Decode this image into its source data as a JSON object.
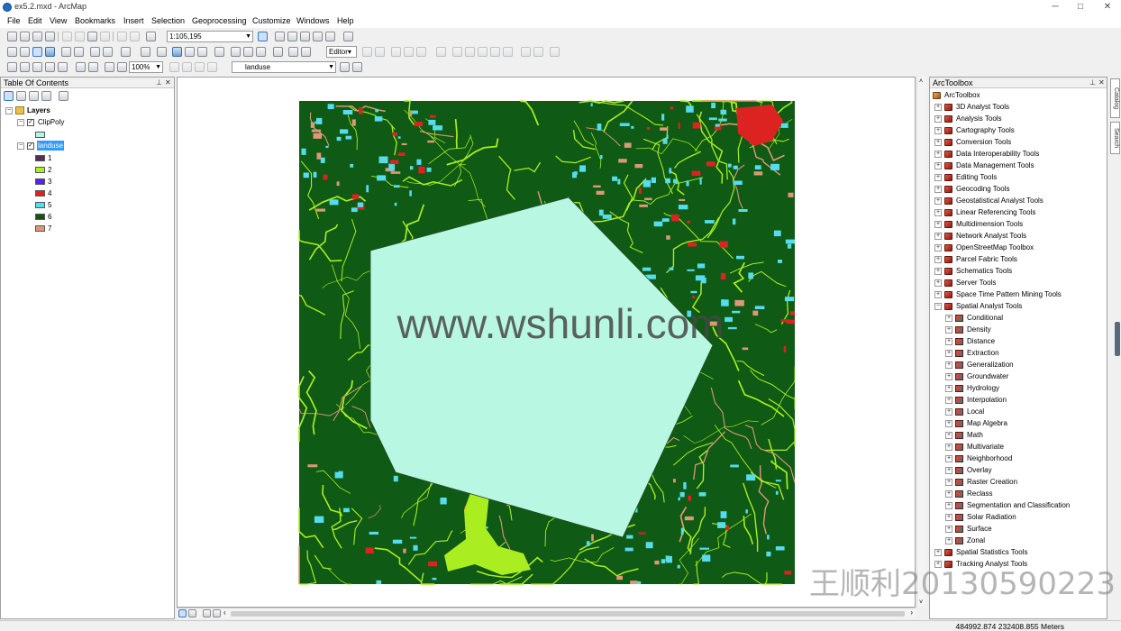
{
  "window": {
    "title": "ex5.2.mxd - ArcMap",
    "minimize": "─",
    "maximize": "□",
    "close": "✕"
  },
  "menu": [
    "File",
    "Edit",
    "View",
    "Bookmarks",
    "Insert",
    "Selection",
    "Geoprocessing",
    "Customize",
    "Windows",
    "Help"
  ],
  "toolbar": {
    "scale": "1:105,195",
    "zoom": "100%",
    "editor": "Editor▾",
    "layer": "landuse"
  },
  "toc": {
    "title": "Table Of Contents",
    "root": "Layers",
    "layers": [
      {
        "name": "ClipPoly",
        "checked": true
      },
      {
        "name": "landuse",
        "checked": true
      }
    ],
    "clip_swatch": "#b8f5e0",
    "classes": [
      {
        "label": "1",
        "color": "#5a2a5a"
      },
      {
        "label": "2",
        "color": "#aaee22"
      },
      {
        "label": "3",
        "color": "#5522ee"
      },
      {
        "label": "4",
        "color": "#dd2222"
      },
      {
        "label": "5",
        "color": "#55ddee"
      },
      {
        "label": "6",
        "color": "#115511"
      },
      {
        "label": "7",
        "color": "#dd9977"
      }
    ]
  },
  "map": {
    "watermark": "www.wshunli.com",
    "background_color": "#0f5a14",
    "polygon_color": "#b8f8e2"
  },
  "toolbox": {
    "title": "ArcToolbox",
    "root": "ArcToolbox",
    "toolsets": [
      "3D Analyst Tools",
      "Analysis Tools",
      "Cartography Tools",
      "Conversion Tools",
      "Data Interoperability Tools",
      "Data Management Tools",
      "Editing Tools",
      "Geocoding Tools",
      "Geostatistical Analyst Tools",
      "Linear Referencing Tools",
      "Multidimension Tools",
      "Network Analyst Tools",
      "OpenStreetMap Toolbox",
      "Parcel Fabric Tools",
      "Schematics Tools",
      "Server Tools",
      "Space Time Pattern Mining Tools"
    ],
    "expanded": "Spatial Analyst Tools",
    "spatial_children": [
      "Conditional",
      "Density",
      "Distance",
      "Extraction",
      "Generalization",
      "Groundwater",
      "Hydrology",
      "Interpolation",
      "Local",
      "Map Algebra",
      "Math",
      "Multivariate",
      "Neighborhood",
      "Overlay",
      "Raster Creation",
      "Reclass",
      "Segmentation and Classification",
      "Solar Radiation",
      "Surface",
      "Zonal"
    ],
    "after": [
      "Spatial Statistics Tools",
      "Tracking Analyst Tools"
    ]
  },
  "sidetabs": [
    "Catalog",
    "Search"
  ],
  "status": {
    "coords": "484992.874  232408.855 Meters"
  },
  "watermark_cn": "王顺利20130590223"
}
